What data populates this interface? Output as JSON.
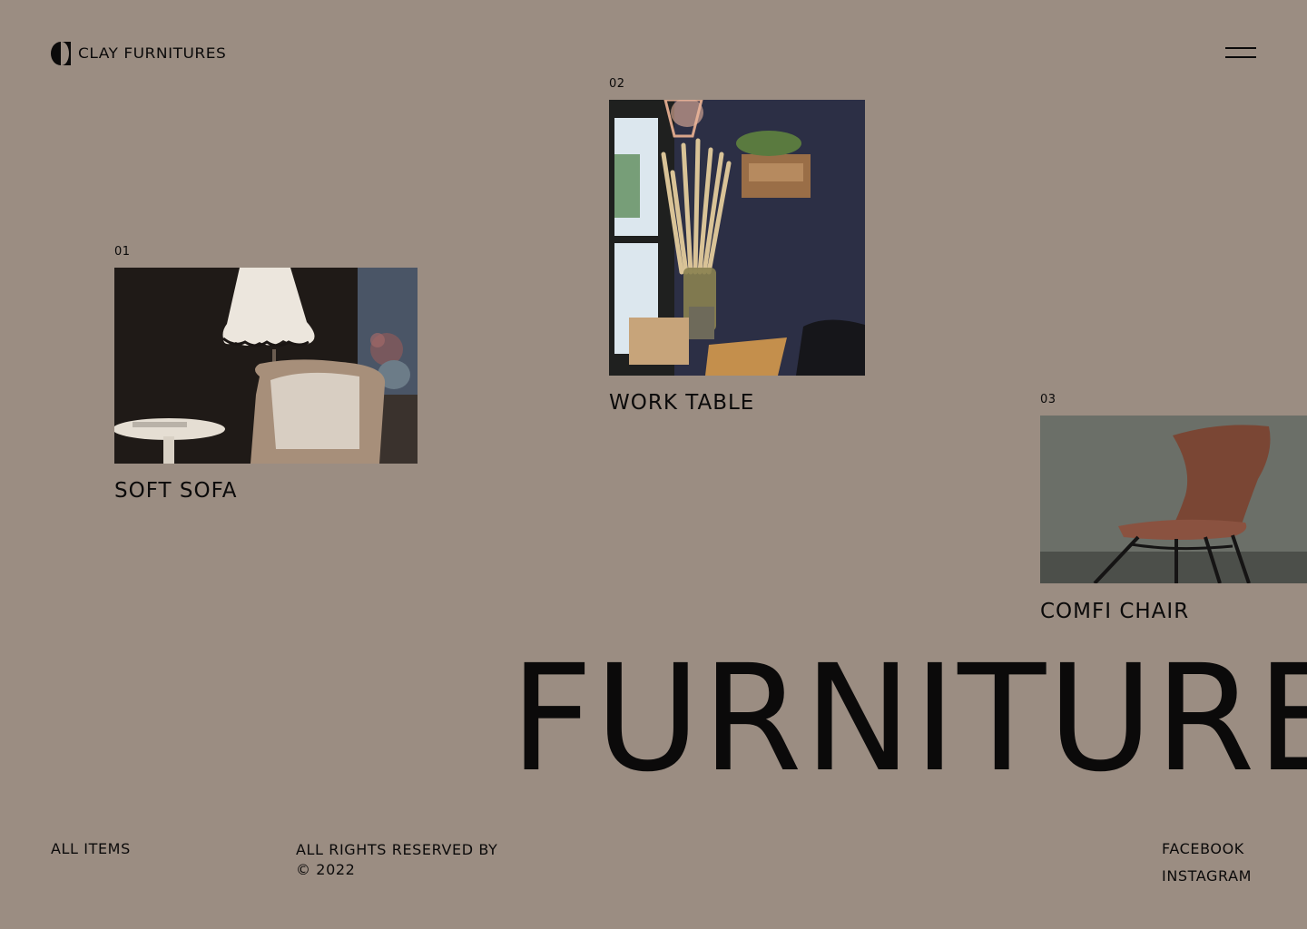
{
  "brand": {
    "name": "CLAY FURNITURES"
  },
  "products": [
    {
      "number": "01",
      "title": "SOFT SOFA"
    },
    {
      "number": "02",
      "title": "WORK TABLE"
    },
    {
      "number": "03",
      "title": "COMFI CHAIR"
    }
  ],
  "headline": "FURNITURE",
  "footer": {
    "all_items": "ALL ITEMS",
    "rights_line1": "ALL RIGHTS RESERVED BY",
    "rights_line2": "© 2022",
    "facebook": "FACEBOOK",
    "instagram": "INSTAGRAM"
  },
  "colors": {
    "background": "#9b8d82",
    "text": "#0b0a0a"
  },
  "icons": {
    "logo": "half-circles-logo-icon",
    "menu": "hamburger-menu-icon"
  }
}
